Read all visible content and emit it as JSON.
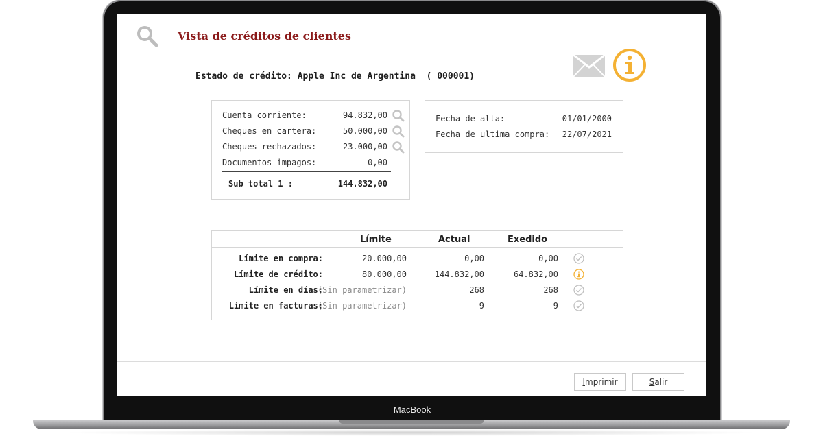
{
  "device": {
    "brand_label": "MacBook"
  },
  "header": {
    "title": "Vista de créditos de clientes",
    "title_color": "#8b1a1a"
  },
  "status_line": {
    "label": "Estado de crédito:",
    "client_name": "Apple Inc de Argentina",
    "client_code": "( 000001)"
  },
  "icons": {
    "search": "search-icon",
    "mail": "mail-icon",
    "info": "info-icon",
    "check": "check-circle-icon",
    "accent": "#f4b133"
  },
  "balances": {
    "rows": [
      {
        "label": "Cuenta corriente:",
        "value": "94.832,00"
      },
      {
        "label": "Cheques en cartera:",
        "value": "50.000,00"
      },
      {
        "label": "Cheques rechazados:",
        "value": "23.000,00"
      },
      {
        "label": "Documentos impagos:",
        "value": "0,00"
      }
    ],
    "subtotal_label": "Sub total 1 :",
    "subtotal_value": "144.832,00"
  },
  "dates": {
    "rows": [
      {
        "label": "Fecha de alta:",
        "value": "01/01/2000"
      },
      {
        "label": "Fecha de ultima compra:",
        "value": "22/07/2021"
      }
    ]
  },
  "limits": {
    "headers": {
      "limit": "Límite",
      "actual": "Actual",
      "exceeded": "Exedido"
    },
    "rows": [
      {
        "label": "Límite en compra:",
        "limit": "20.000,00",
        "actual": "0,00",
        "exceeded": "0,00",
        "status": "ok"
      },
      {
        "label": "Límite de crédito:",
        "limit": "80.000,00",
        "actual": "144.832,00",
        "exceeded": "64.832,00",
        "status": "warning"
      },
      {
        "label": "Límite en días:",
        "limit": "(Sin parametrizar)",
        "actual": "268",
        "exceeded": "268",
        "status": "ok"
      },
      {
        "label": "Límite en facturas:",
        "limit": "(Sin parametrizar)",
        "actual": "9",
        "exceeded": "9",
        "status": "ok"
      }
    ]
  },
  "footer": {
    "print_button": {
      "mnemonic": "I",
      "rest": "mprimir"
    },
    "exit_button": {
      "mnemonic": "S",
      "rest": "alir"
    }
  }
}
